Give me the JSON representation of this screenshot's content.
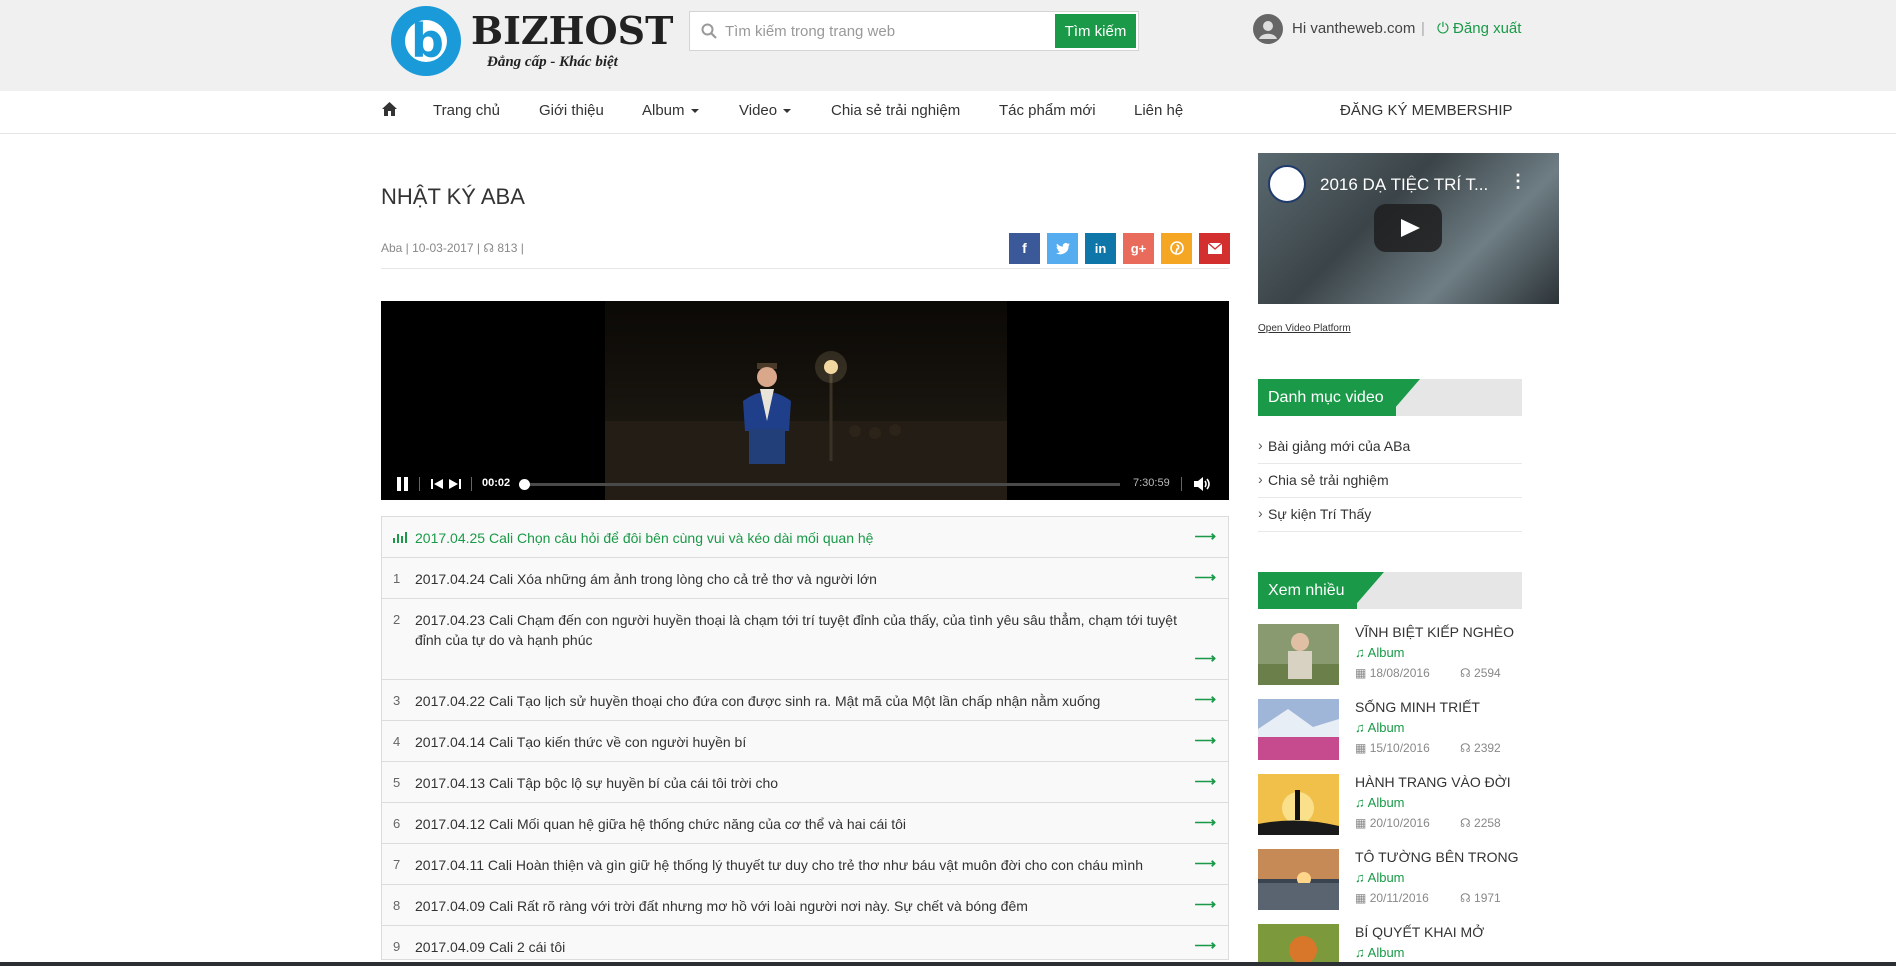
{
  "header": {
    "logo_text": "BIZHOST",
    "logo_tagline": "Đẳng cấp - Khác biệt",
    "search": {
      "placeholder": "Tìm kiếm trong trang web",
      "button_label": "Tìm kiếm"
    },
    "user": {
      "greeting": "Hi vantheweb.com",
      "separator": "|",
      "logout_label": "Đăng xuất"
    }
  },
  "nav": {
    "home_icon": "home-icon",
    "items": [
      {
        "label": "Trang chủ"
      },
      {
        "label": "Giới thiệu"
      },
      {
        "label": "Album"
      },
      {
        "label": "Video"
      },
      {
        "label": "Chia sẻ trải nghiệm"
      },
      {
        "label": "Tác phẩm mới"
      },
      {
        "label": "Liên hệ"
      }
    ],
    "membership_label": "ĐĂNG KÝ MEMBERSHIP"
  },
  "article": {
    "title": "NHẬT KÝ ABA",
    "meta_prefix": "Aba | 10-03-2017 |",
    "views": "813",
    "meta_suffix": "|",
    "share_icons": [
      "facebook-icon",
      "twitter-icon",
      "linkedin-icon",
      "google-plus-icon",
      "pinterest-icon",
      "email-icon"
    ]
  },
  "player": {
    "current_time": "00:02",
    "duration": "7:30:59",
    "progress": 0.004
  },
  "playlist": [
    {
      "num": "",
      "text": "2017.04.25 Cali Chọn câu hỏi để đôi bên cùng vui và kéo dài mối quan hệ",
      "active": true
    },
    {
      "num": "1",
      "text": "2017.04.24 Cali Xóa những ám ảnh trong lòng cho cả trẻ thơ và người lớn"
    },
    {
      "num": "2",
      "text": "2017.04.23 Cali Chạm đến con người huyền thoại là chạm tới trí tuyệt đỉnh của thấy, của tình yêu sâu thẳm, chạm tới tuyệt đỉnh của tự do và hạnh phúc"
    },
    {
      "num": "3",
      "text": "2017.04.22 Cali Tạo lịch sử huyền thoại cho đứa con được sinh ra. Mật mã của Một lần chấp nhận nằm xuống"
    },
    {
      "num": "4",
      "text": "2017.04.14 Cali Tạo kiến thức về con người huyền bí"
    },
    {
      "num": "5",
      "text": "2017.04.13 Cali Tập bộc lộ sự huyền bí của cái tôi trời cho"
    },
    {
      "num": "6",
      "text": "2017.04.12 Cali Mối quan hệ giữa hệ thống chức năng của cơ thể và hai cái tôi"
    },
    {
      "num": "7",
      "text": "2017.04.11 Cali Hoàn thiện và gìn giữ hệ thống lý thuyết tư duy cho trẻ thơ như báu vật muôn đời cho con cháu mình"
    },
    {
      "num": "8",
      "text": "2017.04.09 Cali Rất rõ ràng với trời đất nhưng mơ hồ với loài người nơi này. Sự chết và bóng đêm"
    },
    {
      "num": "9",
      "text": "2017.04.09 Cali 2 cái tôi"
    }
  ],
  "sidebar": {
    "video": {
      "title": "2016 DẠ TIỆC TRÍ T...",
      "link": "Open Video Platform"
    },
    "categories": {
      "title": "Danh mục video",
      "items": [
        "Bài giảng mới của ABa",
        "Chia sẻ trải nghiệm",
        "Sự kiện Trí Thấy"
      ]
    },
    "popular": {
      "title": "Xem nhiều",
      "items": [
        {
          "title": "VĨNH BIỆT KIẾP NGHÈO",
          "category": "Album",
          "date": "18/08/2016",
          "views": "2594"
        },
        {
          "title": "SỐNG MINH TRIẾT",
          "category": "Album",
          "date": "15/10/2016",
          "views": "2392"
        },
        {
          "title": "HÀNH TRANG VÀO ĐỜI",
          "category": "Album",
          "date": "20/10/2016",
          "views": "2258"
        },
        {
          "title": "TÔ TƯỜNG BÊN TRONG",
          "category": "Album",
          "date": "20/11/2016",
          "views": "1971"
        },
        {
          "title": "BÍ QUYẾT KHAI MỞ",
          "category": "Album",
          "date": "",
          "views": ""
        }
      ]
    }
  },
  "colors": {
    "brand_green": "#1a9a48",
    "logo_blue": "#1a9ad8",
    "facebook": "#3b5998",
    "twitter": "#55acee",
    "linkedin": "#0e76a8",
    "google_plus": "#e86b5c",
    "pinterest": "#f5a623",
    "email": "#d32f2f"
  }
}
